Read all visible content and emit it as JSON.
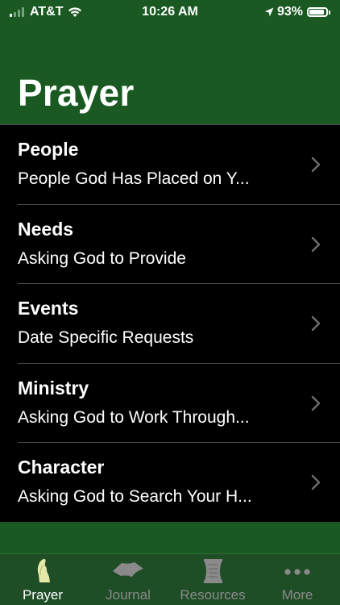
{
  "status_bar": {
    "carrier": "AT&T",
    "time": "10:26 AM",
    "battery_percent": "93%",
    "battery_level": 0.93,
    "signal_bars": 4,
    "signal_bars_active": 1
  },
  "header": {
    "title": "Prayer"
  },
  "list": {
    "items": [
      {
        "title": "People",
        "subtitle": "People God Has Placed on Y..."
      },
      {
        "title": "Needs",
        "subtitle": "Asking God to Provide"
      },
      {
        "title": "Events",
        "subtitle": "Date Specific Requests"
      },
      {
        "title": "Ministry",
        "subtitle": "Asking God to Work Through..."
      },
      {
        "title": "Character",
        "subtitle": "Asking God to Search Your H..."
      }
    ]
  },
  "tab_bar": {
    "tabs": [
      {
        "label": "Prayer",
        "icon": "praying-hands-icon",
        "active": true
      },
      {
        "label": "Journal",
        "icon": "book-icon",
        "active": false
      },
      {
        "label": "Resources",
        "icon": "scroll-icon",
        "active": false
      },
      {
        "label": "More",
        "icon": "more-dots-icon",
        "active": false
      }
    ]
  },
  "colors": {
    "header_green": "#1a5a22",
    "tab_bar_green": "#1f4d26",
    "list_background": "#000000",
    "active_tab": "#ffffff",
    "inactive_tab": "#8a8a8a",
    "chevron": "#6d6d6d"
  }
}
